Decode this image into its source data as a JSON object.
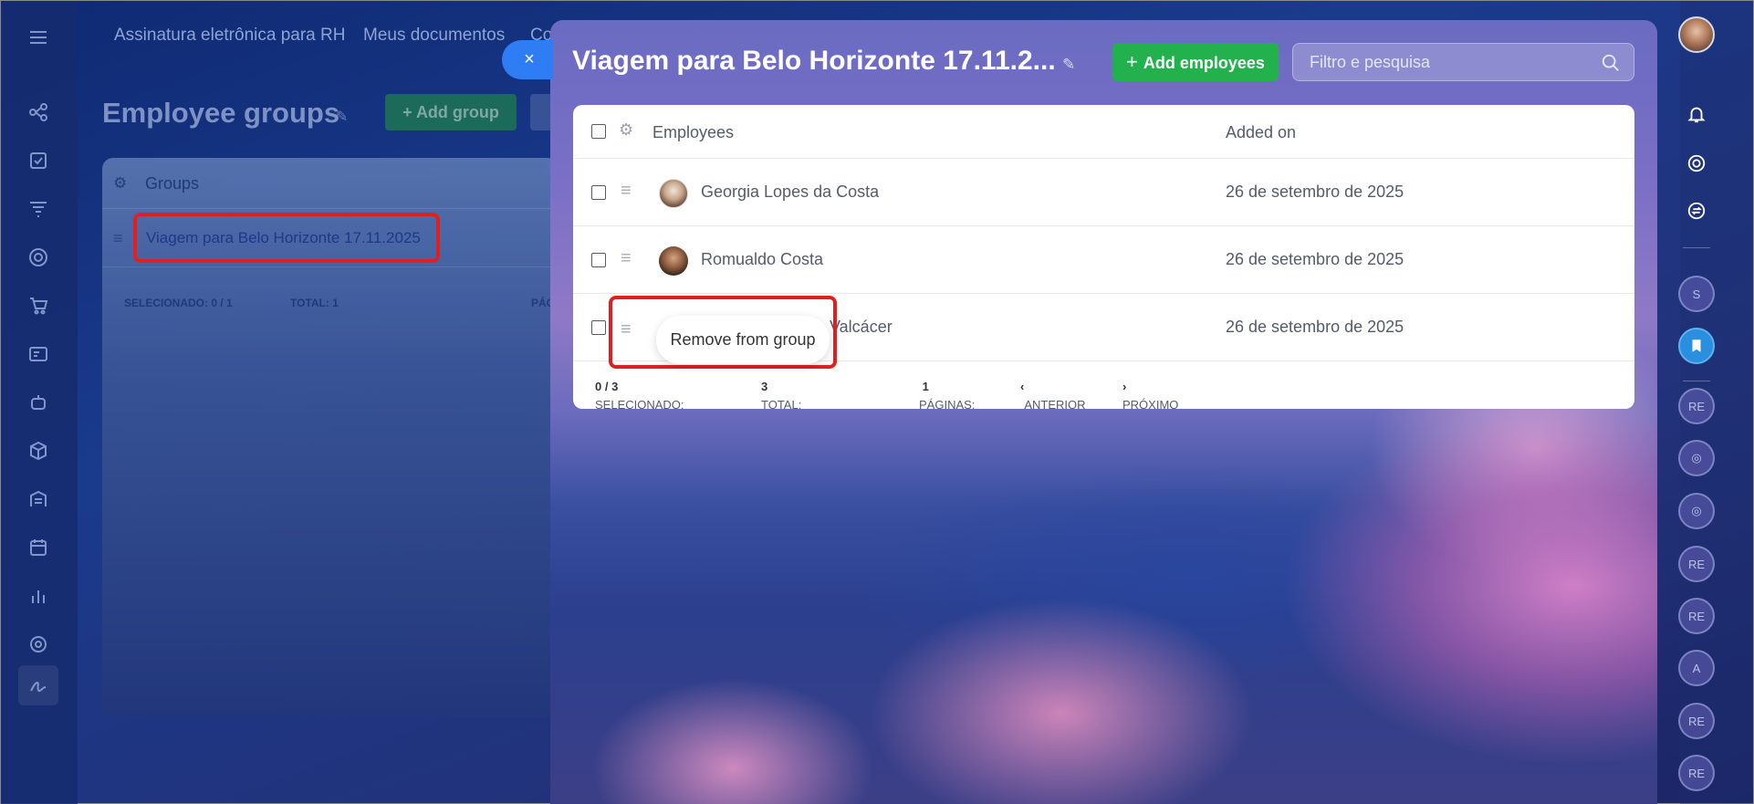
{
  "background_nav": {
    "items": [
      "Assinatura eletrônica para RH",
      "Meus documentos",
      "Co"
    ]
  },
  "background_page": {
    "title": "Employee groups",
    "add_group_label": "Add group",
    "groups_header": "Groups",
    "group_name": "Viagem para Belo Horizonte 17.11.2025",
    "selected_label": "SELECIONADO:",
    "selected_value": "0 / 1",
    "total_label": "TOTAL:",
    "total_value": "1",
    "pages_label": "PÁG"
  },
  "slider": {
    "close_icon": "×",
    "title": "Viagem para Belo Horizonte 17.11.2...",
    "add_employees_label": "Add employees",
    "search_placeholder": "Filtro e pesquisa",
    "columns": [
      "Employees",
      "Added on"
    ],
    "rows": [
      {
        "name": "Georgia Lopes da Costa",
        "added_on": "26 de setembro de 2025"
      },
      {
        "name": "Romualdo Costa",
        "added_on": "26 de setembro de 2025"
      },
      {
        "name": "Valcácer",
        "added_on": "26 de setembro de 2025"
      }
    ],
    "tooltip": "Remove from group",
    "footer": {
      "selected_label": "SELECIONADO:",
      "selected_value": "0 / 3",
      "total_label": "TOTAL:",
      "total_value": "3",
      "pages_label": "PÁGINAS:",
      "pages_value": "1",
      "prev_label": "ANTERIOR",
      "next_label": "PRÓXIMO"
    }
  },
  "right_rail": {
    "bubbles": [
      "S",
      "RE",
      "RE",
      "RE",
      "A",
      "RE",
      "RE"
    ]
  },
  "colors": {
    "accent_blue": "#2f7df4",
    "add_green": "#22b14c",
    "highlight_red": "#e02020"
  }
}
